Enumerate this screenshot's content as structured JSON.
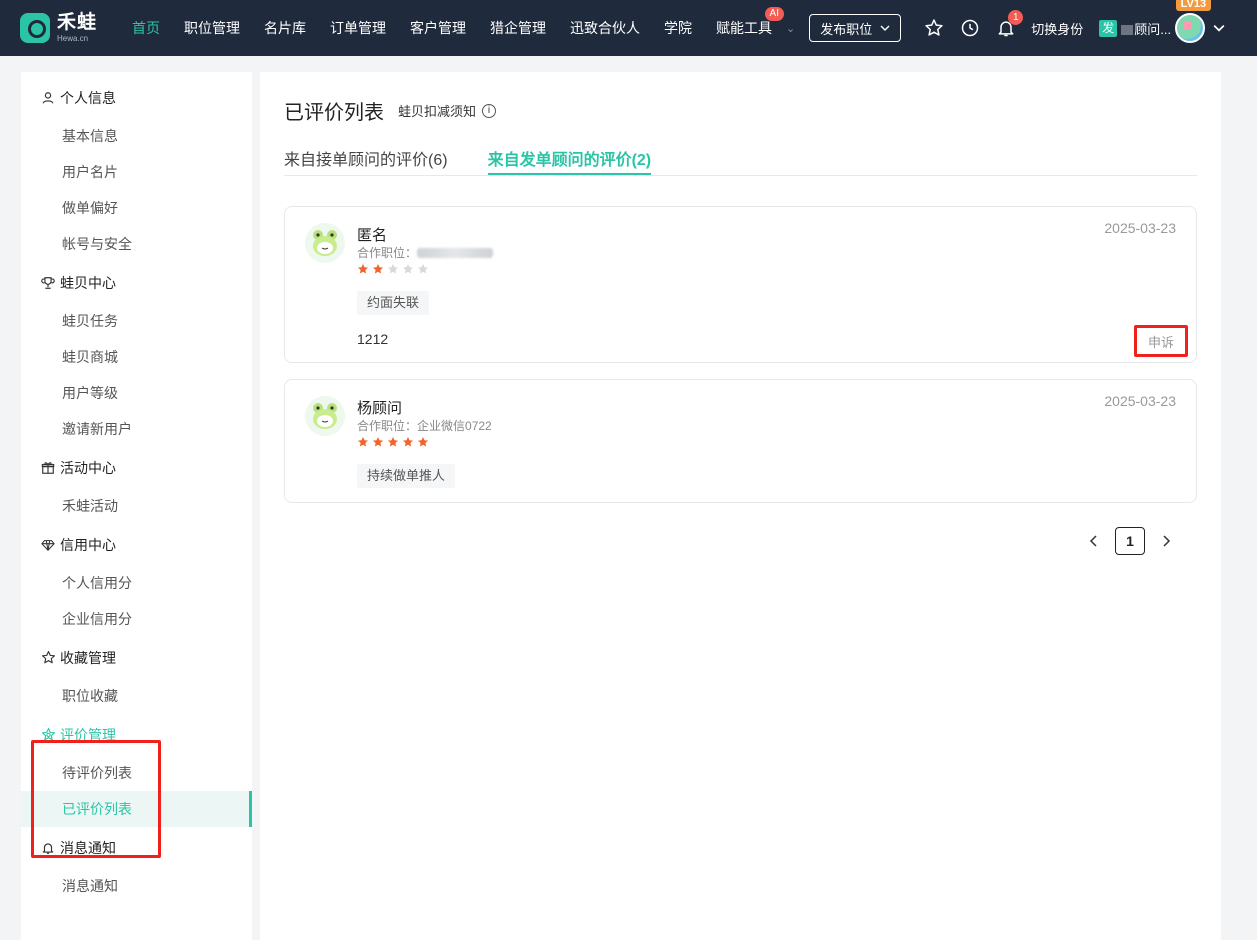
{
  "app": {
    "logo_name": "禾蛙",
    "logo_sub": "Hewa.cn"
  },
  "topnav": {
    "items": [
      {
        "label": "首页",
        "active": true
      },
      {
        "label": "职位管理"
      },
      {
        "label": "名片库"
      },
      {
        "label": "订单管理"
      },
      {
        "label": "客户管理"
      },
      {
        "label": "猎企管理"
      },
      {
        "label": "迅致合伙人"
      },
      {
        "label": "学院"
      },
      {
        "label": "赋能工具"
      }
    ],
    "ai_badge": "AI",
    "publish_label": "发布职位",
    "bell_count": "1",
    "switch_identity": "切换身份",
    "role_tag": "发",
    "user_name": "顾问...",
    "level": "LV13"
  },
  "sidebar": {
    "groups": [
      {
        "title": "个人信息",
        "icon": "person-icon",
        "items": [
          "基本信息",
          "用户名片",
          "做单偏好",
          "帐号与安全"
        ]
      },
      {
        "title": "蛙贝中心",
        "icon": "trophy-icon",
        "items": [
          "蛙贝任务",
          "蛙贝商城",
          "用户等级",
          "邀请新用户"
        ]
      },
      {
        "title": "活动中心",
        "icon": "gift-icon",
        "items": [
          "禾蛙活动"
        ]
      },
      {
        "title": "信用中心",
        "icon": "diamond-icon",
        "items": [
          "个人信用分",
          "企业信用分"
        ]
      },
      {
        "title": "收藏管理",
        "icon": "star-outline-icon",
        "items": [
          "职位收藏"
        ]
      },
      {
        "title": "评价管理",
        "icon": "review-icon",
        "items": [
          "待评价列表",
          "已评价列表"
        ],
        "active": true
      },
      {
        "title": "消息通知",
        "icon": "bell-icon",
        "items": [
          "消息通知"
        ]
      }
    ],
    "active_item": "已评价列表"
  },
  "main": {
    "title": "已评价列表",
    "deduct_link": "蛙贝扣减须知",
    "tabs": [
      {
        "label": "来自接单顾问的评价(6)"
      },
      {
        "label": "来自发单顾问的评价(2)",
        "active": true
      }
    ],
    "reviews": [
      {
        "name": "匿名",
        "position_label": "合作职位：",
        "position_value": "",
        "rating": 2,
        "max_rating": 5,
        "tag": "约面失联",
        "content": "1212",
        "date": "2025-03-23",
        "appeal_label": "申诉"
      },
      {
        "name": "杨顾问",
        "position_label": "合作职位：",
        "position_value": "企业微信0722",
        "rating": 5,
        "max_rating": 5,
        "tag": "持续做单推人",
        "content": "",
        "date": "2025-03-23"
      }
    ],
    "pagination": {
      "current": "1"
    }
  },
  "colors": {
    "accent": "#2bc4a6",
    "nav_bg": "#1f2a3c",
    "star_on": "#f2642c",
    "star_off": "#d9d9d9",
    "highlight": "#f0201d"
  }
}
